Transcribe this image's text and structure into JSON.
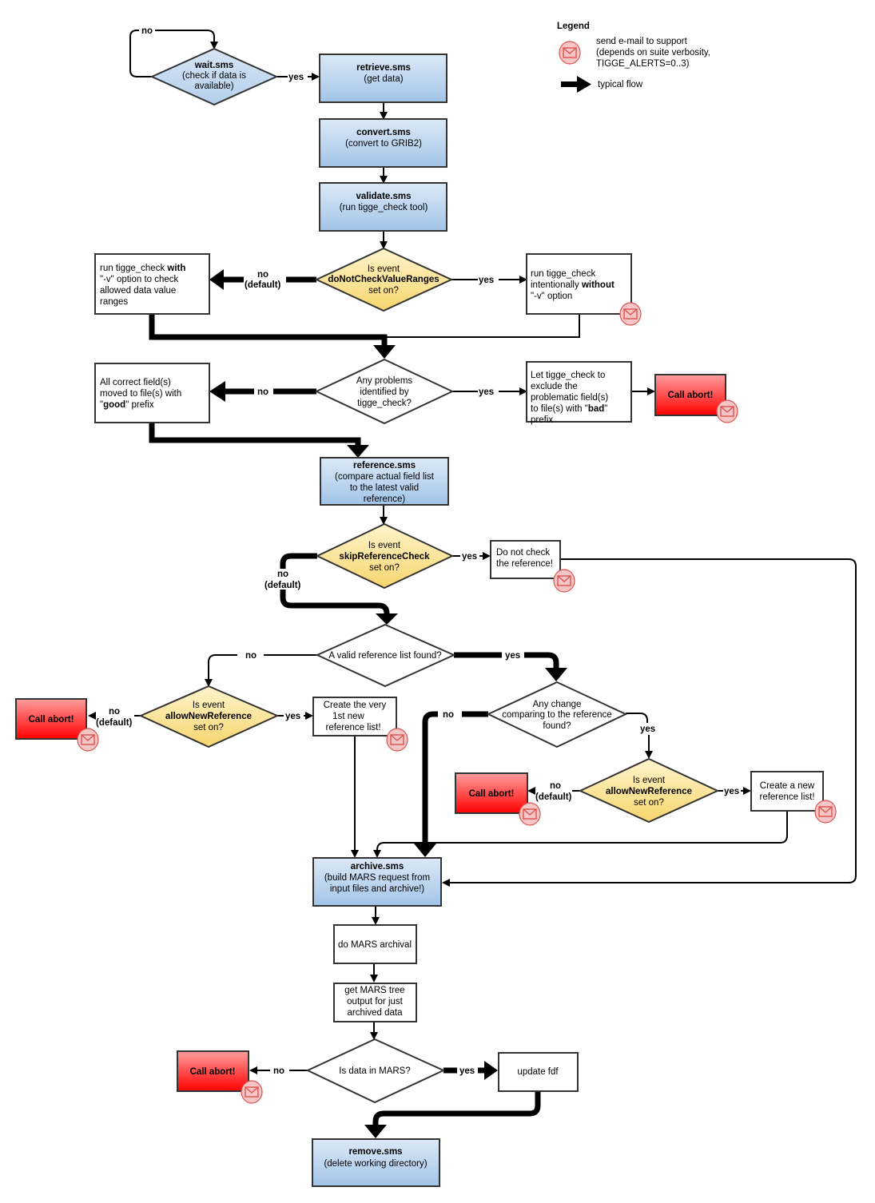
{
  "legend": {
    "title": "Legend",
    "email": [
      "send e-mail to support",
      "(depends on suite verbosity,",
      "TIGGE_ALERTS=0..3)"
    ],
    "flow": "typical flow"
  },
  "colors": {
    "task_blue_top": "#dce9f7",
    "task_blue_bottom": "#a2c4e8",
    "decision_yellow_top": "#fff4cc",
    "decision_yellow_bottom": "#f7d66e",
    "decision_blue": "#c6daf0",
    "abort_top": "#ff9a9a",
    "abort_bottom": "#ff0000",
    "mail_fill": "#f6c6c6",
    "mail_stroke": "#d9534f"
  },
  "nodes": {
    "wait": {
      "title": "wait.sms",
      "lines": [
        "(check if data is",
        "available)"
      ]
    },
    "retrieve": {
      "title": "retrieve.sms",
      "lines": [
        "(get data)"
      ]
    },
    "convert": {
      "title": "convert.sms",
      "lines": [
        "(convert to GRIB2)"
      ]
    },
    "validate": {
      "title": "validate.sms",
      "lines": [
        "(run tigge_check tool)"
      ]
    },
    "dnc": {
      "lines": [
        "Is event",
        "doNotCheckValueRanges",
        "set on?"
      ]
    },
    "with_v": {
      "l1a": "run tigge_check ",
      "l1b": "with",
      "l2": "\"-v\" option to check",
      "l3": "allowed data value",
      "l4": "ranges"
    },
    "without_v": {
      "l1": "run tigge_check",
      "l2a": "intentionally ",
      "l2b": "without",
      "l3": "\"-v\" option"
    },
    "problems": {
      "lines": [
        "Any problems",
        "identified by",
        "tigge_check?"
      ]
    },
    "good": {
      "l1": "All correct field(s)",
      "l2": "moved to file(s) with",
      "l3a": "\"",
      "l3b": "good",
      "l3c": "\" prefix"
    },
    "bad": {
      "l1": "Let tigge_check to",
      "l2": "exclude the",
      "l3": "problematic field(s)",
      "l4a": "to file(s) with \"",
      "l4b": "bad",
      "l4c": "\"",
      "l5": "prefix"
    },
    "abort": "Call abort!",
    "reference": {
      "title": "reference.sms",
      "lines": [
        "(compare actual field list",
        "to the latest valid",
        "reference)"
      ]
    },
    "skip": {
      "lines": [
        "Is event",
        "skipReferenceCheck",
        "set on?"
      ]
    },
    "donot": {
      "lines": [
        "Do not check",
        "the reference!"
      ]
    },
    "valid": {
      "lines": [
        "A valid reference list found?"
      ]
    },
    "allow": {
      "lines": [
        "Is event",
        "allowNewReference",
        "set on?"
      ]
    },
    "first": {
      "lines": [
        "Create the very",
        "1st new",
        "reference list!"
      ]
    },
    "change": {
      "lines": [
        "Any change",
        "comparing to the reference",
        "found?"
      ]
    },
    "createnew": {
      "lines": [
        "Create a new",
        "reference list!"
      ]
    },
    "archive": {
      "title": "archive.sms",
      "lines": [
        "(build MARS request from",
        "input files and archive!)"
      ]
    },
    "mars": {
      "lines": [
        "do MARS archival"
      ]
    },
    "tree": {
      "lines": [
        "get MARS tree",
        "output for just",
        "archived data"
      ]
    },
    "inmars": {
      "lines": [
        "Is data in MARS?"
      ]
    },
    "fdf": {
      "lines": [
        "update fdf"
      ]
    },
    "remove": {
      "title": "remove.sms",
      "lines": [
        "(delete working directory)"
      ]
    }
  },
  "labels": {
    "yes": "yes",
    "no": "no",
    "default": "(default)"
  }
}
